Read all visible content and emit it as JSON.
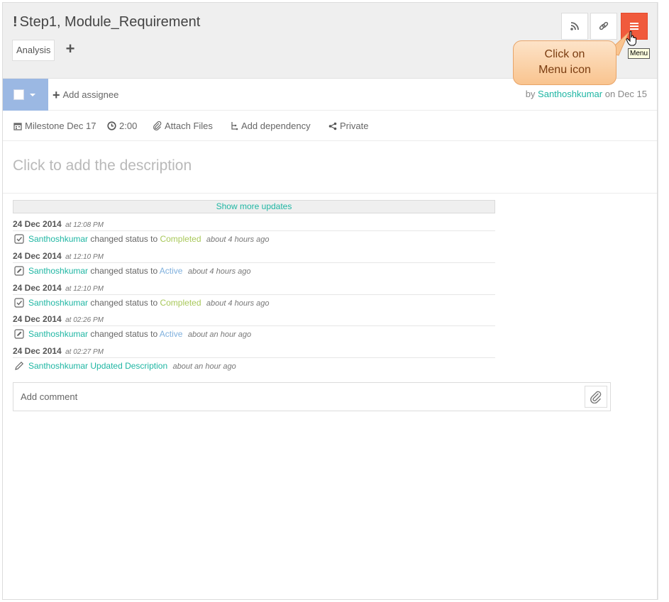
{
  "header": {
    "bang": "!",
    "title": "Step1, Module_Requirement",
    "tag": "Analysis",
    "add_tag": "+",
    "tooltip": "Menu",
    "icons": [
      "rss-icon",
      "link-icon",
      "menu-icon"
    ],
    "menu_color": "#f05a3c"
  },
  "callout": {
    "line1": "Click on",
    "line2": "Menu icon"
  },
  "assign": {
    "add_label": "Add assignee",
    "by_prefix": "by",
    "by_user": "Santhoshkumar",
    "by_suffix": "on Dec 15",
    "status_color": "#9bb8e3"
  },
  "meta": {
    "milestone": "Milestone Dec 17",
    "time": "2:00",
    "attach": "Attach Files",
    "dependency": "Add dependency",
    "privacy": "Private"
  },
  "description": {
    "placeholder": "Click to add the description"
  },
  "updates": {
    "show_more": "Show more updates",
    "items": [
      {
        "date": "24 Dec 2014",
        "time": "at 12:08 PM",
        "icon": "checkbox-icon",
        "user": "Santhoshkumar",
        "action": "changed status to",
        "status": "Completed",
        "status_color": "#a8c85a",
        "ago": "about 4 hours ago"
      },
      {
        "date": "24 Dec 2014",
        "time": "at 12:10 PM",
        "icon": "edit-box-icon",
        "user": "Santhoshkumar",
        "action": "changed status to",
        "status": "Active",
        "status_color": "#7fb0dd",
        "ago": "about 4 hours ago"
      },
      {
        "date": "24 Dec 2014",
        "time": "at 12:10 PM",
        "icon": "checkbox-icon",
        "user": "Santhoshkumar",
        "action": "changed status to",
        "status": "Completed",
        "status_color": "#a8c85a",
        "ago": "about 4 hours ago"
      },
      {
        "date": "24 Dec 2014",
        "time": "at 02:26 PM",
        "icon": "edit-box-icon",
        "user": "Santhoshkumar",
        "action": "changed status to",
        "status": "Active",
        "status_color": "#7fb0dd",
        "ago": "about an hour ago"
      },
      {
        "date": "24 Dec 2014",
        "time": "at 02:27 PM",
        "icon": "pencil-icon",
        "user": "Santhoshkumar",
        "action": "Updated Description",
        "status": "",
        "status_color": "#1fb6a3",
        "ago": "about an hour ago"
      }
    ]
  },
  "comment": {
    "placeholder": "Add comment"
  }
}
